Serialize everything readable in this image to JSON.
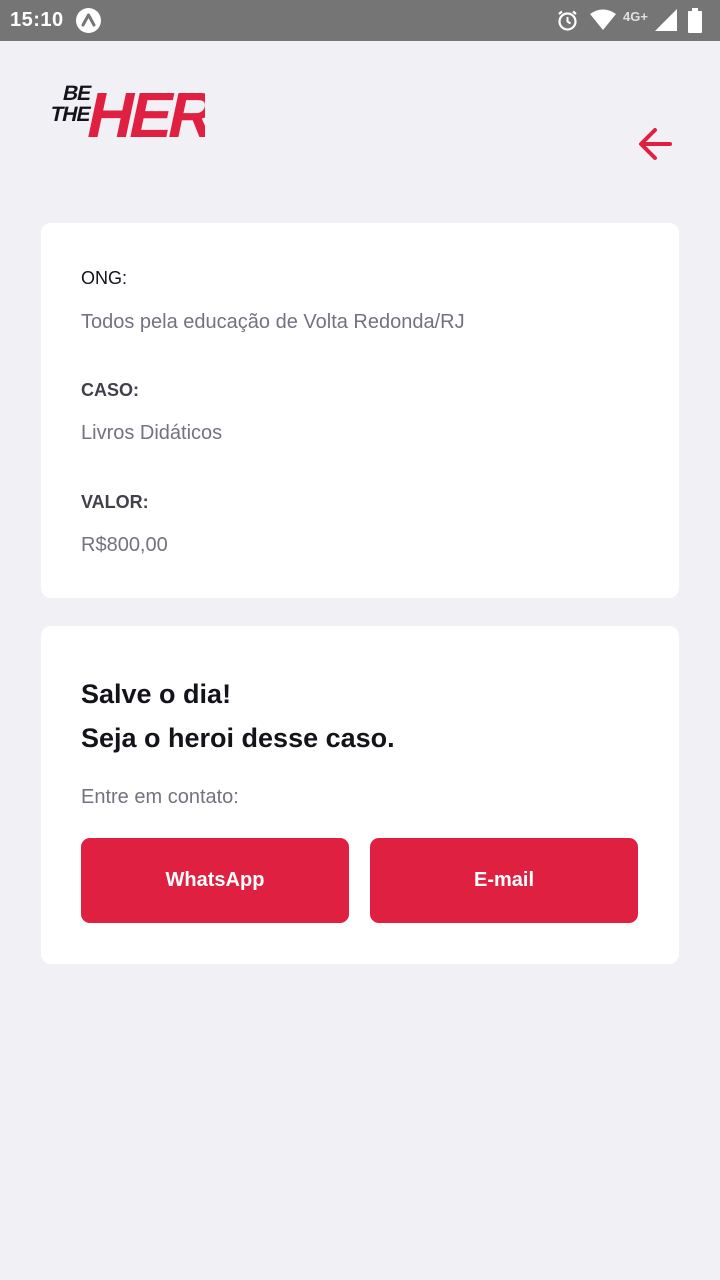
{
  "status_bar": {
    "time": "15:10",
    "network": "4G+",
    "icons": [
      "app-notification-icon",
      "alarm-icon",
      "wifi-icon",
      "signal-icon",
      "battery-icon"
    ]
  },
  "header": {
    "logo_top": "BE",
    "logo_mid": "THE",
    "logo_main": "HERO",
    "back_icon": "arrow-left-icon",
    "accent_color": "#e02041"
  },
  "incident": {
    "ong_label": "ONG:",
    "ong_value": "Todos pela educação  de Volta Redonda/RJ",
    "case_label": "CASO:",
    "case_value": "Livros Didáticos",
    "value_label": "VALOR:",
    "value_value": "R$800,00"
  },
  "contact": {
    "title_line1": "Salve o dia!",
    "title_line2": "Seja o heroi desse caso.",
    "subtitle": "Entre em contato:",
    "whatsapp_label": "WhatsApp",
    "email_label": "E-mail"
  }
}
